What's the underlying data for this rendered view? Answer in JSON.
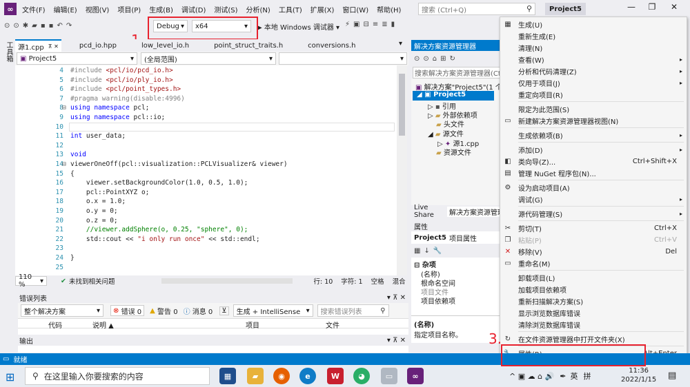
{
  "menubar": {
    "items": [
      "文件(F)",
      "编辑(E)",
      "视图(V)",
      "项目(P)",
      "生成(B)",
      "调试(D)",
      "测试(S)",
      "分析(N)",
      "工具(T)",
      "扩展(X)",
      "窗口(W)",
      "帮助(H)"
    ],
    "search_placeholder": "搜索 (Ctrl+Q)",
    "project_name": "Project5",
    "minimize": "—",
    "restore": "❐",
    "close": "✕"
  },
  "toolbar": {
    "config": "Debug",
    "platform": "x64",
    "debugger": "▶ 本地 Windows 调试器 ▾"
  },
  "annotations": {
    "one": "1.",
    "two": "2.",
    "three": "3."
  },
  "side_tab": "工具箱",
  "editor": {
    "tabs": [
      {
        "label": "源1.cpp",
        "pin": "⊼ ✕"
      },
      {
        "label": "pcd_io.hpp"
      },
      {
        "label": "low_level_io.h"
      },
      {
        "label": "point_struct_traits.h"
      },
      {
        "label": "conversions.h"
      }
    ],
    "nav_project": "Project5",
    "nav_scope": "(全局范围)",
    "lines": [
      {
        "n": "4",
        "t": "#include <pcl/io/pcd_io.h>",
        "k": "inc"
      },
      {
        "n": "5",
        "t": "#include <pcl/io/ply_io.h>",
        "k": "inc"
      },
      {
        "n": "6",
        "t": "#include <pcl/point_types.h>",
        "k": "inc"
      },
      {
        "n": "7",
        "t": "#pragma warning(disable:4996)",
        "k": "pp"
      },
      {
        "n": "8",
        "t": "using namespace pcl;",
        "k": "using",
        "fold": "⊟"
      },
      {
        "n": "9",
        "t": "using namespace pcl::io;",
        "k": "using"
      },
      {
        "n": "10",
        "t": "",
        "k": ""
      },
      {
        "n": "11",
        "t": "int user_data;",
        "k": "int"
      },
      {
        "n": "12",
        "t": "",
        "k": ""
      },
      {
        "n": "13",
        "t": "void",
        "k": "kw"
      },
      {
        "n": "14",
        "t": "viewerOneOff(pcl::visualization::PCLVisualizer& viewer)",
        "k": "",
        "fold": "⊟"
      },
      {
        "n": "15",
        "t": "{",
        "k": ""
      },
      {
        "n": "16",
        "t": "    viewer.setBackgroundColor(1.0, 0.5, 1.0);",
        "k": ""
      },
      {
        "n": "17",
        "t": "    pcl::PointXYZ o;",
        "k": ""
      },
      {
        "n": "18",
        "t": "    o.x = 1.0;",
        "k": ""
      },
      {
        "n": "19",
        "t": "    o.y = 0;",
        "k": ""
      },
      {
        "n": "20",
        "t": "    o.z = 0;",
        "k": ""
      },
      {
        "n": "21",
        "t": "    //viewer.addSphere(o, 0.25, \"sphere\", 0);",
        "k": "cm"
      },
      {
        "n": "22",
        "t": "    std::cout << \"i only run once\" << std::endl;",
        "k": "cout"
      },
      {
        "n": "23",
        "t": "",
        "k": ""
      },
      {
        "n": "24",
        "t": "}",
        "k": ""
      },
      {
        "n": "25",
        "t": "",
        "k": ""
      }
    ],
    "zoom": "110 %",
    "issues": "未找到相关问题",
    "position_line": "行: 10",
    "position_char": "字符: 1",
    "ws": "空格",
    "eol": "混合"
  },
  "error_list": {
    "title": "错误列表",
    "scope": "整个解决方案",
    "errors": "错误 0",
    "warnings": "警告 0",
    "messages": "消息 0",
    "build_filter": "生成 + IntelliSense",
    "search": "搜索错误列表",
    "columns": [
      "代码",
      "说明 ▲",
      "项目",
      "文件"
    ]
  },
  "output": {
    "title": "输出"
  },
  "solution_explorer": {
    "title": "解决方案资源管理器",
    "search": "搜索解决方案资源管理器(Ctrl+;)",
    "solution": "解决方案\"Project5\"(1 个",
    "project": "Project5",
    "nodes": [
      "引用",
      "外部依赖项",
      "头文件",
      "源文件",
      "源1.cpp",
      "资源文件"
    ],
    "tabs": [
      "Live Share",
      "解决方案资源管理器"
    ]
  },
  "properties": {
    "title": "属性",
    "subject": "Project5",
    "subject_type": "项目属性",
    "category": "杂项",
    "rows": [
      "(名称)",
      "根命名空间",
      "项目文件",
      "项目依赖项"
    ],
    "desc_title": "(名称)",
    "desc_text": "指定项目名称。"
  },
  "context_menu": {
    "items": [
      {
        "icon": "▦",
        "label": "生成(U)"
      },
      {
        "icon": "",
        "label": "重新生成(E)"
      },
      {
        "icon": "",
        "label": "清理(N)"
      },
      {
        "icon": "",
        "label": "查看(W)",
        "arrow": "▸"
      },
      {
        "icon": "",
        "label": "分析和代码清理(Z)",
        "arrow": "▸"
      },
      {
        "icon": "",
        "label": "仅用于项目(J)",
        "arrow": "▸"
      },
      {
        "icon": "",
        "label": "重定向项目(R)",
        "sep_after": true
      },
      {
        "icon": "",
        "label": "限定为此范围(S)"
      },
      {
        "icon": "▭",
        "label": "新建解决方案资源管理器视图(N)",
        "sep_after": true
      },
      {
        "icon": "",
        "label": "生成依赖项(B)",
        "arrow": "▸",
        "sep_after": true
      },
      {
        "icon": "",
        "label": "添加(D)",
        "arrow": "▸"
      },
      {
        "icon": "◧",
        "label": "类向导(Z)...",
        "shortcut": "Ctrl+Shift+X"
      },
      {
        "icon": "▤",
        "label": "管理 NuGet 程序包(N)...",
        "sep_after": true
      },
      {
        "icon": "⚙",
        "label": "设为启动项目(A)"
      },
      {
        "icon": "",
        "label": "调试(G)",
        "arrow": "▸",
        "sep_after": true
      },
      {
        "icon": "",
        "label": "源代码管理(S)",
        "arrow": "▸",
        "sep_after": true
      },
      {
        "icon": "✂",
        "label": "剪切(T)",
        "shortcut": "Ctrl+X"
      },
      {
        "icon": "❐",
        "label": "粘贴(P)",
        "shortcut": "Ctrl+V",
        "disabled": true
      },
      {
        "icon": "✕",
        "label": "移除(V)",
        "shortcut": "Del",
        "red": true
      },
      {
        "icon": "▭",
        "label": "重命名(M)",
        "sep_after": true
      },
      {
        "icon": "",
        "label": "卸载项目(L)"
      },
      {
        "icon": "",
        "label": "加载项目依赖项"
      },
      {
        "icon": "",
        "label": "重新扫描解决方案(S)"
      },
      {
        "icon": "",
        "label": "显示浏览数据库错误"
      },
      {
        "icon": "",
        "label": "清除浏览数据库错误",
        "sep_after": true
      },
      {
        "icon": "↻",
        "label": "在文件资源管理器中打开文件夹(X)",
        "sep_after": true
      },
      {
        "icon": "🔧",
        "label": "属性(R)",
        "shortcut": "Alt+Enter"
      }
    ]
  },
  "statusbar": {
    "text": "就绪"
  },
  "taskbar": {
    "search": "在这里输入你要搜索的内容",
    "ime": "英",
    "ime2": "拼",
    "time": "11:36",
    "date": "2022/1/15",
    "tray_icons": "^ ▣ ☁ ⌂ 🔊"
  }
}
